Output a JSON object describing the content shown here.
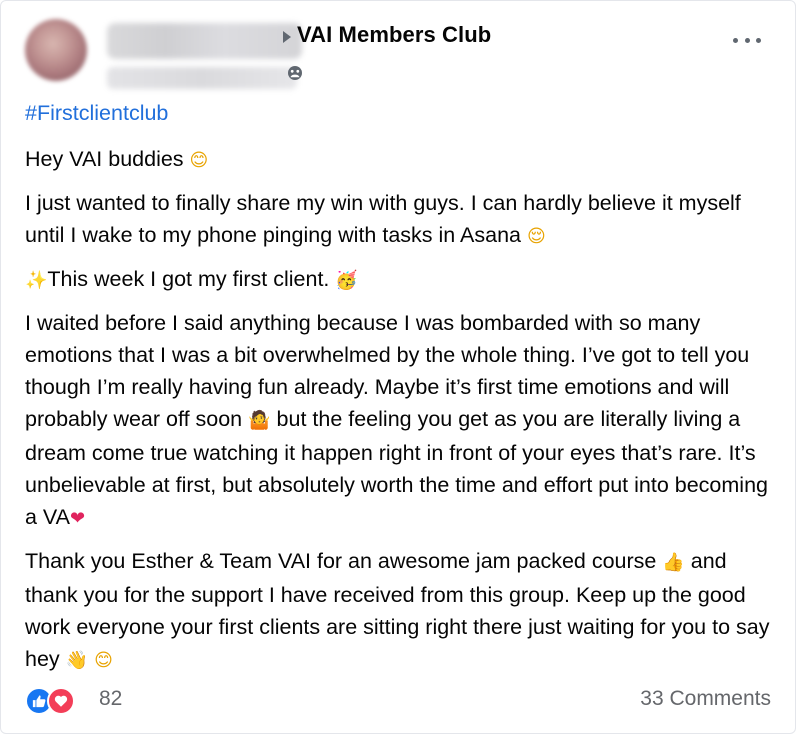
{
  "post": {
    "group_name": "VAI Members Club",
    "hashtag": "#Firstclientclub",
    "paragraphs": {
      "p1": "Hey VAI buddies",
      "p2": "I just wanted to finally share my win with guys. I can hardly believe it myself until I wake to my phone pinging with tasks in Asana",
      "p3": "This week I got my first client.",
      "p4a": "I waited before I said anything because I was bombarded with so many emotions that I was a bit overwhelmed by the whole thing. I’ve got to tell you though I’m really having fun already. Maybe it’s first time emotions and will probably wear off soon",
      "p4b": "but the feeling you get as you are literally living a dream come true watching it happen right in front of your eyes that’s rare. It’s unbelievable at first, but absolutely worth the time and effort put into becoming a VA",
      "p5a": "Thank you Esther & Team VAI for an awesome jam packed course",
      "p5b": "and thank you for the support I have received from this group. Keep up the good work everyone your first clients are sitting right there just waiting for you to say hey"
    },
    "emojis": {
      "smile": "😊",
      "relieved": "😌",
      "sparkles": "✨",
      "party": "🥳",
      "shrug": "🤷",
      "heart": "❤",
      "thumbs_up": "👍",
      "wave": "👋"
    }
  },
  "footer": {
    "reaction_count": "82",
    "comments": "33 Comments"
  },
  "icons": {
    "like": "like-icon",
    "love": "love-icon",
    "globe": "group-privacy-icon",
    "more": "more-options-icon"
  },
  "colors": {
    "hashtag": "#216fdb",
    "like": "#1877f2",
    "love": "#f33e58",
    "muted_text": "#65676b"
  }
}
